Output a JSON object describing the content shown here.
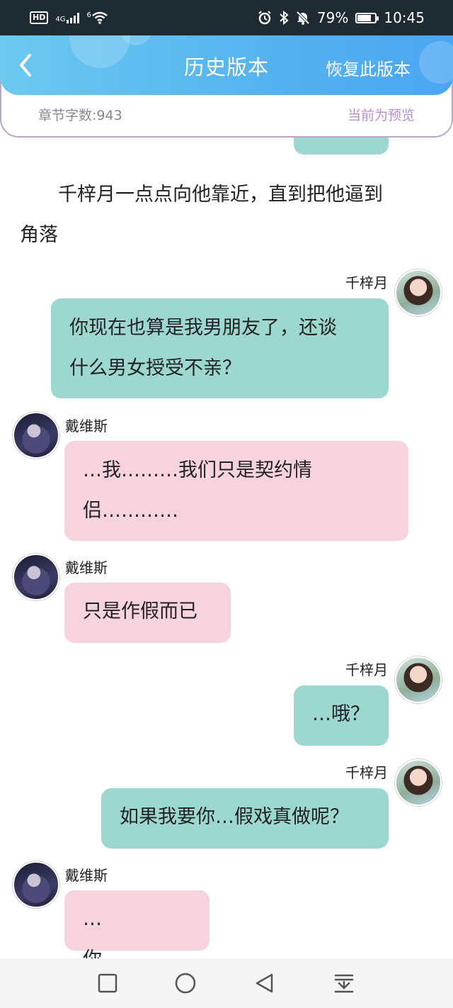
{
  "status_bar": {
    "hd": "HD",
    "network": "4G",
    "wifi_sup": "6",
    "battery_percent": "79%",
    "battery_level": 0.79,
    "time": "10:45",
    "icons": [
      "alarm-icon",
      "bluetooth-icon",
      "mute-icon"
    ]
  },
  "header": {
    "title": "历史版本",
    "restore_label": "恢复此版本",
    "word_count": "章节字数:943",
    "preview_label": "当前为预览"
  },
  "colors": {
    "header_start": "#6cc9ef",
    "header_end": "#4aa6f2",
    "right_bubble": "#9dd8d0",
    "left_bubble": "#f6d3dd",
    "preview_text": "#b68ed0"
  },
  "content": {
    "narration_line1": "千梓月一点点向他靠近，直到把他逼到",
    "narration_line2": "角落",
    "messages": [
      {
        "speaker": "千梓月",
        "side": "right",
        "lines": [
          "你现在也算是我男朋友了，还谈",
          "什么男女授受不亲？"
        ]
      },
      {
        "speaker": "戴维斯",
        "side": "left",
        "lines": [
          "…我………我们只是契约情",
          "侣…………"
        ]
      },
      {
        "speaker": "戴维斯",
        "side": "left",
        "lines": [
          "只是作假而已"
        ]
      },
      {
        "speaker": "千梓月",
        "side": "right",
        "lines": [
          "…哦？"
        ]
      },
      {
        "speaker": "千梓月",
        "side": "right",
        "lines": [
          "如果我要你…假戏真做呢？"
        ]
      },
      {
        "speaker": "戴维斯",
        "side": "left",
        "lines": [
          "…你……………"
        ]
      }
    ]
  },
  "nav_bar": {
    "buttons": [
      "recent-apps-icon",
      "home-icon",
      "back-icon",
      "notification-pulldown-icon"
    ]
  }
}
